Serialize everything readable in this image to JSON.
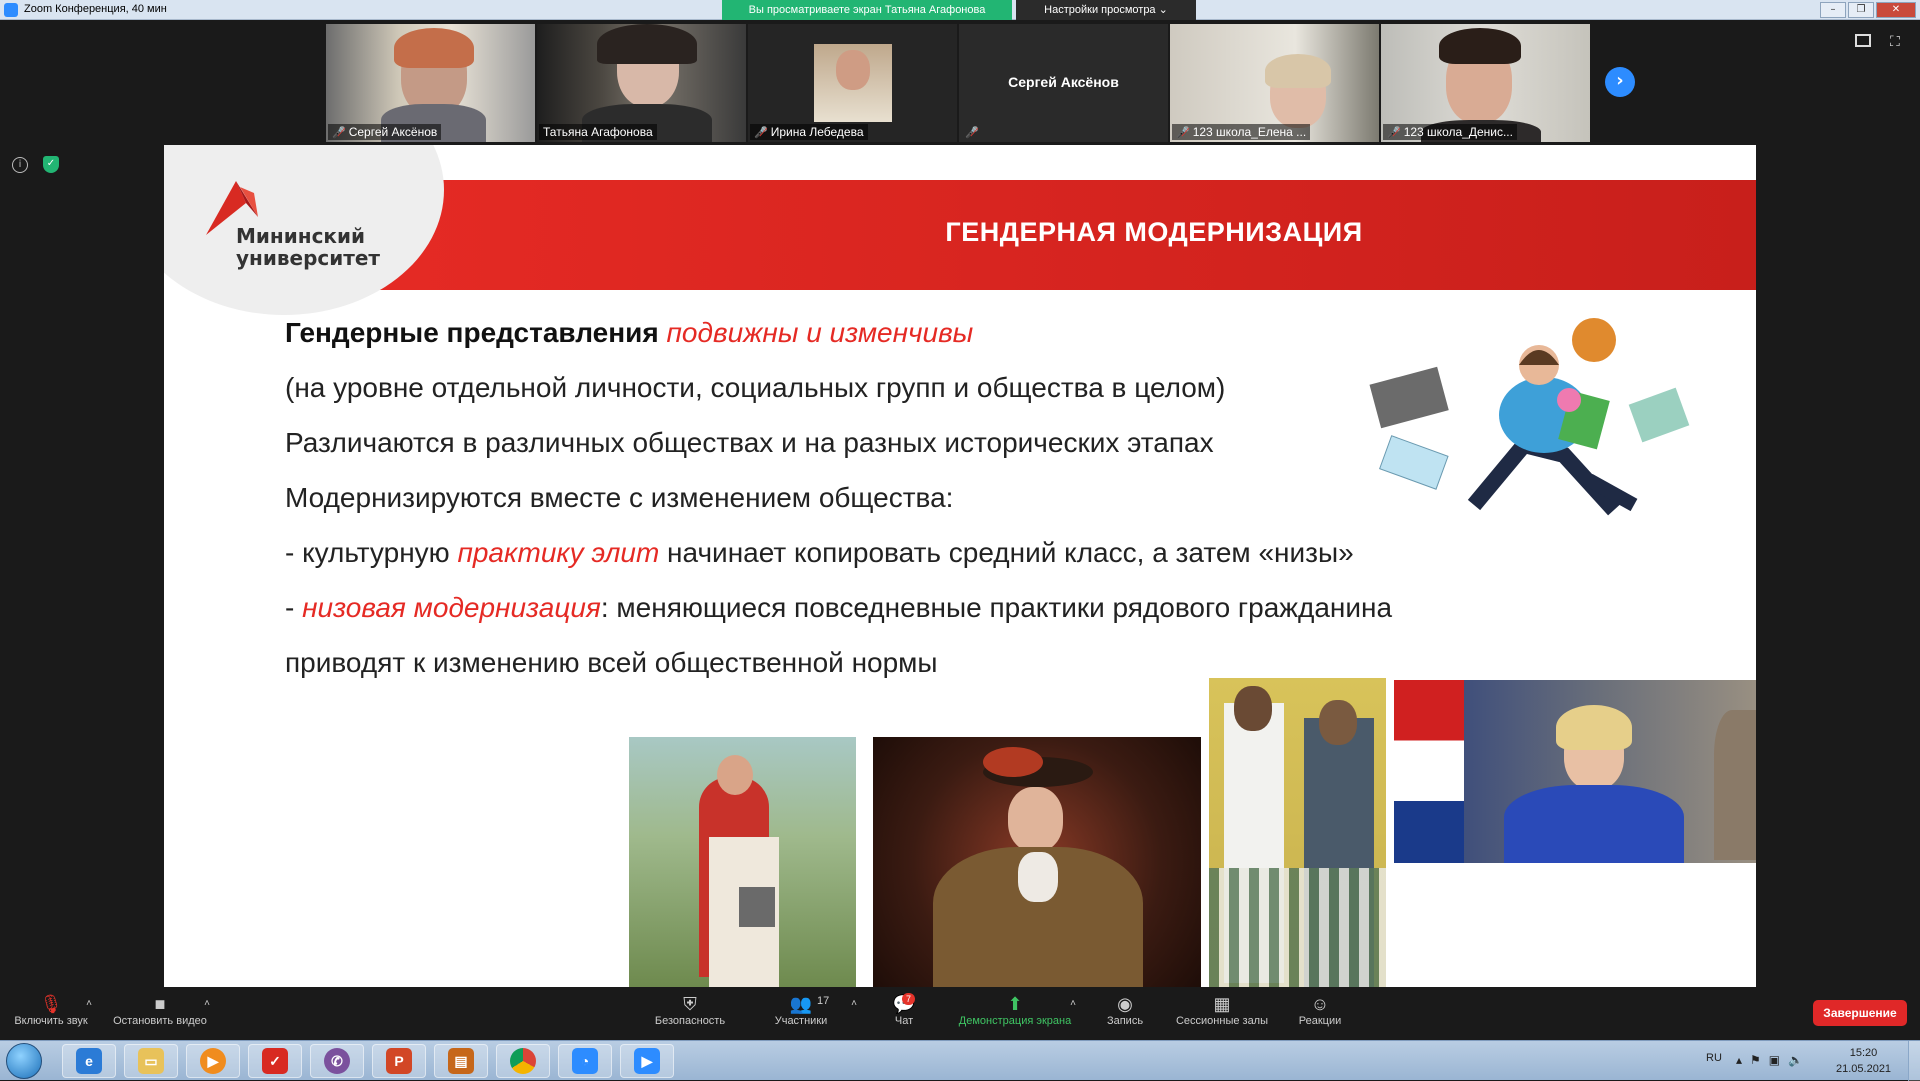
{
  "window": {
    "title": "Zoom Конференция, 40 мин",
    "share_banner": "Вы просматриваете экран Татьяна Агафонова",
    "view_options": "Настройки просмотра ⌄"
  },
  "participants": [
    {
      "name": "Сергей Аксёнов",
      "muted": true,
      "active": false
    },
    {
      "name": "Татьяна Агафонова",
      "muted": false,
      "active": true
    },
    {
      "name": "Ирина Лебедева",
      "muted": true,
      "active": false
    },
    {
      "name": "",
      "center_name": "Сергей Аксёнов",
      "muted": true,
      "active": false
    },
    {
      "name": "123 школа_Елена ...",
      "muted": true,
      "active": false
    },
    {
      "name": "123 школа_Денис...",
      "muted": true,
      "active": false
    }
  ],
  "slide": {
    "logo_line1": "Мининский",
    "logo_line2": "университет",
    "title": "ГЕНДЕРНАЯ МОДЕРНИЗАЦИЯ",
    "line1_bold": "Гендерные представления",
    "line1_red": "подвижны и изменчивы",
    "line2": "(на уровне отдельной личности, социальных групп и общества в целом)",
    "line3": "Различаются в различных обществах и на разных исторических этапах",
    "line4": "Модернизируются вместе с изменением общества:",
    "line5_pre": "- культурную ",
    "line5_red": "практику элит",
    "line5_post": " начинает копировать средний класс, а затем «низы»",
    "line6_pre": "- ",
    "line6_red": "низовая модернизация",
    "line6_post": ": меняющиеся повседневные практики рядового гражданина",
    "line7": "приводят к изменению всей общественной нормы"
  },
  "toolbar": {
    "audio": "Включить звук",
    "video": "Остановить видео",
    "security": "Безопасность",
    "participants": "Участники",
    "participants_count": "17",
    "chat": "Чат",
    "chat_badge": "7",
    "share": "Демонстрация экрана",
    "record": "Запись",
    "breakout": "Сессионные залы",
    "reactions": "Реакции",
    "end": "Завершение"
  },
  "taskbar": {
    "lang": "RU",
    "time": "15:20",
    "date": "21.05.2021"
  },
  "colors": {
    "slide_red": "#e52a24",
    "zoom_blue": "#2d8cff",
    "share_green": "#22b573",
    "end_red": "#e02828"
  }
}
